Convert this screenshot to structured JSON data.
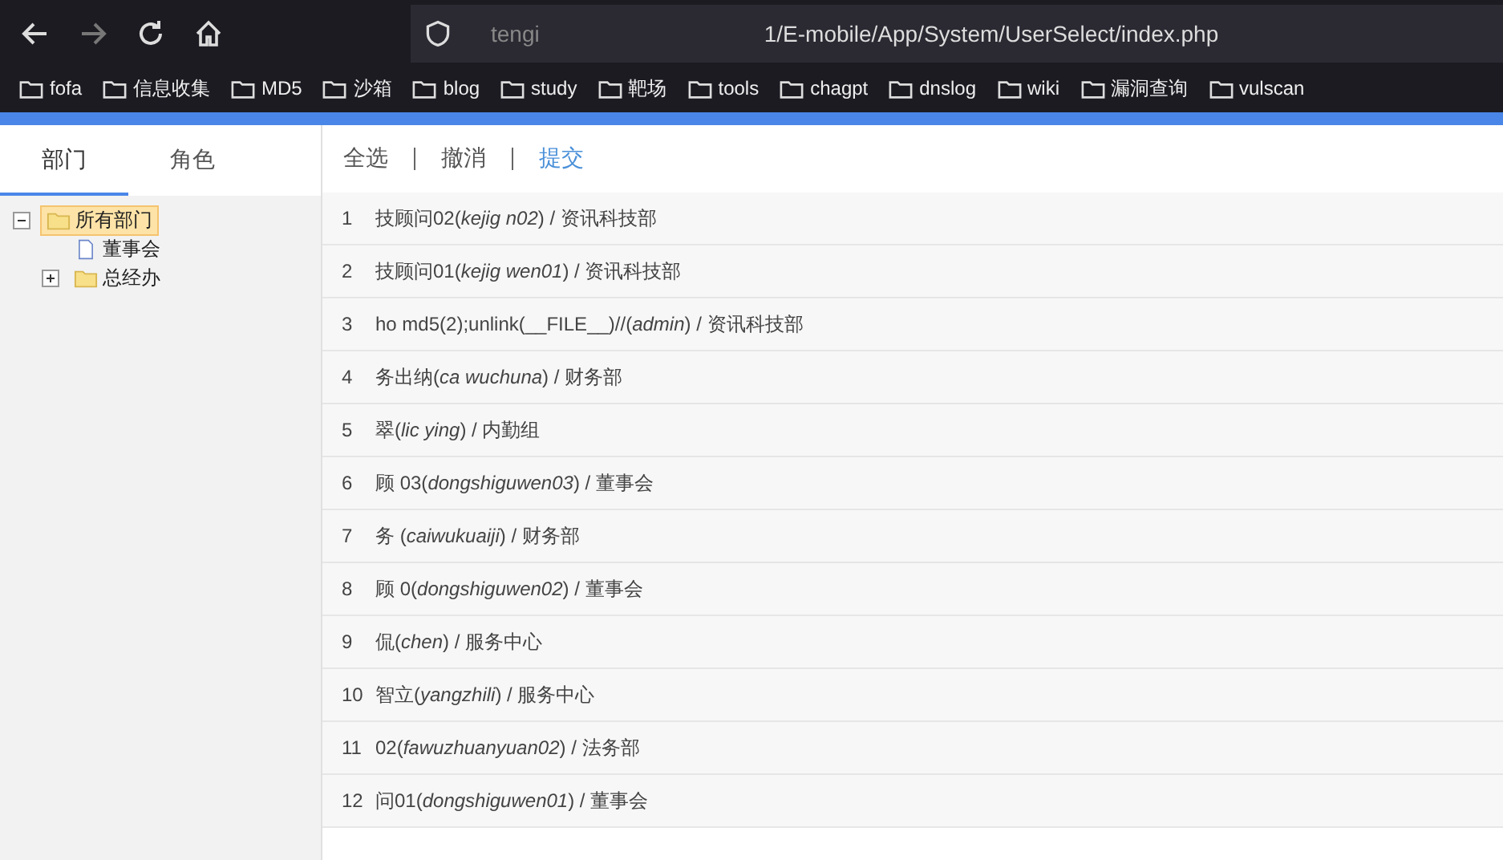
{
  "browser": {
    "url_prefix": "tengi",
    "url": "1/E-mobile/App/System/UserSelect/index.php",
    "bookmarks": [
      "fofa",
      "信息收集",
      "MD5",
      "沙箱",
      "blog",
      "study",
      "靶场",
      "tools",
      "chagpt",
      "dnslog",
      "wiki",
      "漏洞查询",
      "vulscan"
    ]
  },
  "tabs": [
    {
      "label": "部门",
      "selected": true
    },
    {
      "label": "角色",
      "selected": false
    }
  ],
  "tree": [
    {
      "label": "所有部门",
      "selected": true,
      "expanded": true,
      "children": [
        {
          "label": "董事会",
          "selected": false,
          "kind": "leaf"
        },
        {
          "label": "总经办",
          "selected": false,
          "expanded": false,
          "kind": "folder"
        }
      ]
    }
  ],
  "actions": [
    {
      "label": "全选",
      "kind": "plain"
    },
    {
      "label": "撤消",
      "kind": "plain"
    },
    {
      "label": "提交",
      "kind": "primary"
    }
  ],
  "users": [
    {
      "no": "1",
      "text": "技顾问02(*kejig n02*) / 资讯科技部"
    },
    {
      "no": "2",
      "text": "技顾问01(*kejig wen01*) / 资讯科技部"
    },
    {
      "no": "3",
      "text": "ho md5(2);unlink(__FILE__)//(*admin*) / 资讯科技部"
    },
    {
      "no": "4",
      "text": "务出纳(*ca wuchuna*) / 财务部"
    },
    {
      "no": "5",
      "text": "翠(*lic ying*) / 内勤组"
    },
    {
      "no": "6",
      "text": "顾 03(*dongshiguwen03*) / 董事会"
    },
    {
      "no": "7",
      "text": "务 (*caiwukuaiji*) / 财务部"
    },
    {
      "no": "8",
      "text": "顾 0(*dongshiguwen02*) / 董事会"
    },
    {
      "no": "9",
      "text": "侃(*chen*) / 服务中心"
    },
    {
      "no": "10",
      "text": "智立(*yangzhili*) / 服务中心"
    },
    {
      "no": "11",
      "text": "02(*fawuzhuanyuan02*) / 法务部"
    },
    {
      "no": "12",
      "text": "问01(*dongshiguwen01*) / 董事会"
    }
  ]
}
